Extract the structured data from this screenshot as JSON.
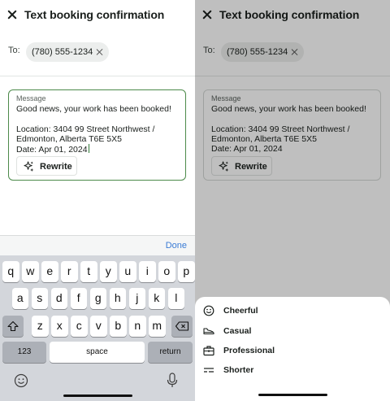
{
  "screen": {
    "title": "Text booking confirmation",
    "to_label": "To:",
    "recipient": "(780) 555-1234",
    "message_label": "Message",
    "message_text": "Good news, your work has been booked!\n\nLocation: 3404 99 Street Northwest / Edmonton, Alberta  T6E 5X5\nDate: Apr 01, 2024",
    "rewrite_label": "Rewrite"
  },
  "keyboard": {
    "done_label": "Done",
    "row1": [
      "q",
      "w",
      "e",
      "r",
      "t",
      "y",
      "u",
      "i",
      "o",
      "p"
    ],
    "row2": [
      "a",
      "s",
      "d",
      "f",
      "g",
      "h",
      "j",
      "k",
      "l"
    ],
    "row3": [
      "z",
      "x",
      "c",
      "v",
      "b",
      "n",
      "m"
    ],
    "numbers_label": "123",
    "space_label": "space",
    "return_label": "return"
  },
  "rewrite_sheet": {
    "options": [
      {
        "label": "Cheerful",
        "icon": "smile-icon"
      },
      {
        "label": "Casual",
        "icon": "sneaker-icon"
      },
      {
        "label": "Professional",
        "icon": "briefcase-icon"
      },
      {
        "label": "Shorter",
        "icon": "shorter-icon"
      }
    ]
  },
  "colors": {
    "accent_green": "#4c8a4a",
    "done_blue": "#3a7bd5"
  }
}
